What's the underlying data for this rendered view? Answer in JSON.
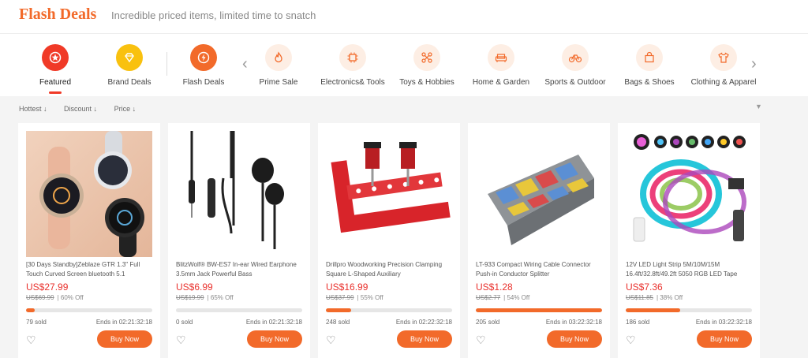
{
  "header": {
    "title": "Flash Deals",
    "subtitle": "Incredible priced items, limited time to snatch"
  },
  "categories": [
    {
      "label": "Featured",
      "icon": "star-badge-icon",
      "active": true
    },
    {
      "label": "Brand Deals",
      "icon": "diamond-icon"
    },
    {
      "label": "Flash Deals",
      "icon": "lightning-icon"
    },
    {
      "label": "Prime Sale",
      "icon": "flame-icon"
    },
    {
      "label": "Electronics& Tools",
      "icon": "chip-icon"
    },
    {
      "label": "Toys & Hobbies",
      "icon": "drone-icon"
    },
    {
      "label": "Home & Garden",
      "icon": "sofa-icon"
    },
    {
      "label": "Sports & Outdoor",
      "icon": "bicycle-icon"
    },
    {
      "label": "Bags & Shoes",
      "icon": "bag-icon"
    },
    {
      "label": "Clothing & Apparel",
      "icon": "shirt-icon"
    }
  ],
  "sort": {
    "hottest": "Hottest ↓",
    "discount": "Discount ↓",
    "price": "Price ↓"
  },
  "products": [
    {
      "name": "[30 Days Standby]Zeblaze GTR 1.3\" Full Touch Curved Screen bluetooth 5.1",
      "price": "US$27.99",
      "orig": "US$69.99",
      "off": "| 60% Off",
      "progress": 0.07,
      "sold": "79 sold",
      "ends": "Ends in  02:21:32:18",
      "buy": "Buy Now"
    },
    {
      "name": "BlitzWolf® BW-ES7 In-ear Wired Earphone 3.5mm Jack Powerful Bass",
      "price": "US$6.99",
      "orig": "US$19.99",
      "off": "| 65% Off",
      "progress": 0.0,
      "sold": "0 sold",
      "ends": "Ends in  02:21:32:18",
      "buy": "Buy Now"
    },
    {
      "name": "Drillpro Woodworking Precision Clamping Square L-Shaped Auxiliary",
      "price": "US$16.99",
      "orig": "US$37.99",
      "off": "| 55% Off",
      "progress": 0.2,
      "sold": "248 sold",
      "ends": "Ends in  02:22:32:18",
      "buy": "Buy Now"
    },
    {
      "name": "LT-933 Compact Wiring Cable Connector Push-in Conductor Splitter",
      "price": "US$1.28",
      "orig": "US$2.77",
      "off": "| 54% Off",
      "progress": 1.0,
      "sold": "205 sold",
      "ends": "Ends in  03:22:32:18",
      "buy": "Buy Now"
    },
    {
      "name": "12V LED Light Strip 5M/10M/15M 16.4ft/32.8ft/49.2ft 5050 RGB LED Tape",
      "price": "US$7.36",
      "orig": "US$11.85",
      "off": "| 38% Off",
      "progress": 0.43,
      "sold": "186 sold",
      "ends": "Ends in  03:22:32:18",
      "buy": "Buy Now"
    }
  ]
}
